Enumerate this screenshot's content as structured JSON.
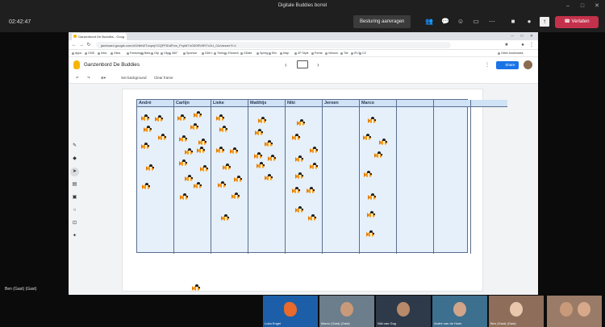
{
  "teams": {
    "window_title": "Digitale Buddies borrel",
    "time": "02:42:47",
    "request_control": "Besturing aanvragen",
    "leave": "Verlaten",
    "self_label": "Ben (Gast) (Gast)",
    "colors": {
      "leave": "#c4314b",
      "bar": "#1f1f1f"
    }
  },
  "browser": {
    "tab_title": "Ganzenbord De Buddies - Goog",
    "url": "jamboard.google.com/d/1NfeWTzopsjYGQFPlDdFhm_PxpMTnGIf0RV9RTx2Lt_0U/viewer?f=1",
    "bookmarks": [
      "Apps",
      "CMS",
      "InfoL",
      "Oliva",
      "Feedzing",
      "Beta",
      "Clip",
      "Clip",
      "360°",
      "Sponsor",
      "DDit L",
      "Trello",
      "XSearch",
      "GDate",
      "Spring",
      "Elin",
      "Map",
      "ZP Style",
      "Portal",
      "Velours",
      "Tile",
      "IFLS",
      "CZ",
      "Other bookmarks"
    ]
  },
  "jamboard": {
    "title": "Ganzenbord De Buddies",
    "set_background": "Set background",
    "clear_frame": "Clear frame",
    "share": "Share",
    "colors": {
      "share": "#1a73e8",
      "table_fill": "#e5f0fb",
      "table_line": "#596d8f"
    }
  },
  "table": {
    "columns": [
      "André",
      "Carlijn",
      "Lieke",
      "Matthijs",
      "Niki",
      "Jeroen",
      "Marco",
      "",
      "",
      ""
    ]
  },
  "participants": [
    {
      "name": "Luka Engel"
    },
    {
      "name": "Marco (Gast) (Gast)"
    },
    {
      "name": "Niki van Gog"
    },
    {
      "name": "André van de Hoek"
    },
    {
      "name": "Ben (Gast) (Gast)"
    },
    {
      "name": ""
    }
  ]
}
